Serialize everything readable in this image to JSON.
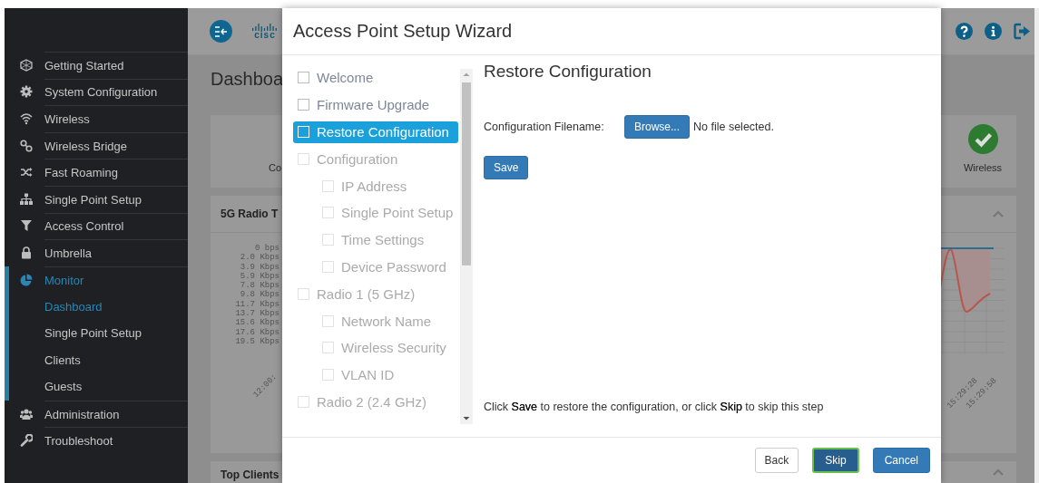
{
  "sidebar": {
    "items": [
      {
        "label": "Getting Started",
        "selected": false
      },
      {
        "label": "System Configuration",
        "selected": false
      },
      {
        "label": "Wireless",
        "selected": false
      },
      {
        "label": "Wireless Bridge",
        "selected": false
      },
      {
        "label": "Fast Roaming",
        "selected": false
      },
      {
        "label": "Single Point Setup",
        "selected": false
      },
      {
        "label": "Access Control",
        "selected": false
      },
      {
        "label": "Umbrella",
        "selected": false
      },
      {
        "label": "Monitor",
        "selected": true,
        "children": [
          {
            "label": "Dashboard",
            "selected": true
          },
          {
            "label": "Single Point Setup",
            "selected": false
          },
          {
            "label": "Clients",
            "selected": false
          },
          {
            "label": "Guests",
            "selected": false
          }
        ]
      },
      {
        "label": "Administration",
        "selected": false
      },
      {
        "label": "Troubleshoot",
        "selected": false
      }
    ]
  },
  "header": {
    "logo_text": "cisc"
  },
  "page_title": "Dashboa",
  "status_cards": [
    {
      "label": "Co"
    },
    {
      "label": "Wireless",
      "ok": true
    }
  ],
  "panels": [
    {
      "title": "5G Radio T",
      "y_labels": [
        "0 bps",
        "2.0 Kbps",
        "3.9 Kbps",
        "5.9 Kbps",
        "7.8 Kbps",
        "9.8 Kbps",
        "11.7 Kbps",
        "13.7 Kbps",
        "15.6 Kbps",
        "17.6 Kbps",
        "19.5 Kbps"
      ],
      "x_labels_left": [
        "12:00:"
      ],
      "x_labels_right": [
        "15:29:28",
        "15:29:58"
      ]
    },
    {
      "title": "Top Clients"
    }
  ],
  "modal": {
    "title": "Access Point Setup Wizard",
    "steps": [
      {
        "label": "Welcome",
        "selected": false,
        "disabled": false,
        "checked": false
      },
      {
        "label": "Firmware Upgrade",
        "selected": false,
        "disabled": false,
        "checked": false
      },
      {
        "label": "Restore Configuration",
        "selected": true,
        "disabled": false,
        "checked": false
      },
      {
        "label": "Configuration",
        "selected": false,
        "disabled": true,
        "checked": false,
        "children": [
          {
            "label": "IP Address",
            "selected": false,
            "disabled": true,
            "checked": false
          },
          {
            "label": "Single Point Setup",
            "selected": false,
            "disabled": true,
            "checked": false
          },
          {
            "label": "Time Settings",
            "selected": false,
            "disabled": true,
            "checked": false
          },
          {
            "label": "Device Password",
            "selected": false,
            "disabled": true,
            "checked": false
          }
        ]
      },
      {
        "label": "Radio 1 (5 GHz)",
        "selected": false,
        "disabled": true,
        "checked": false,
        "children": [
          {
            "label": "Network Name",
            "selected": false,
            "disabled": true,
            "checked": false
          },
          {
            "label": "Wireless Security",
            "selected": false,
            "disabled": true,
            "checked": false
          },
          {
            "label": "VLAN ID",
            "selected": false,
            "disabled": true,
            "checked": false
          }
        ]
      },
      {
        "label": "Radio 2 (2.4 GHz)",
        "selected": false,
        "disabled": true,
        "checked": false
      }
    ],
    "panel": {
      "heading": "Restore Configuration",
      "filename_label": "Configuration Filename:",
      "browse_button": "Browse...",
      "file_status": "No file selected.",
      "save_button": "Save",
      "hint": "Click **Save** to restore the configuration, or click **Skip** to skip this step"
    },
    "footer_buttons": [
      {
        "label": "Back",
        "kind": "default",
        "focused": false
      },
      {
        "label": "Skip",
        "kind": "primary",
        "focused": true
      },
      {
        "label": "Cancel",
        "kind": "primary",
        "focused": false
      }
    ]
  }
}
